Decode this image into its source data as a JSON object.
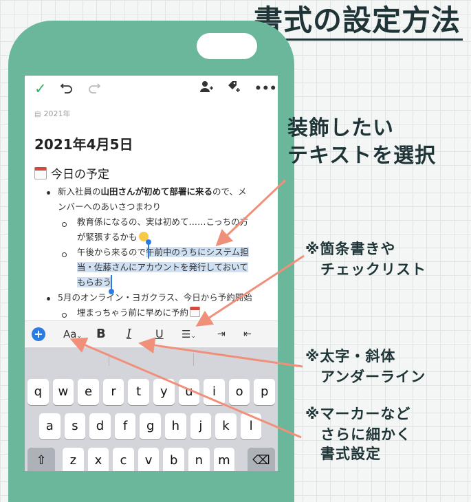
{
  "page_title": "書式の設定方法",
  "toolbar": {
    "check_icon": "check-icon",
    "undo_icon": "undo-icon",
    "redo_icon": "redo-icon",
    "share_icon": "person-add-icon",
    "tag_icon": "tag-add-icon",
    "more_glyph": "•••"
  },
  "note": {
    "notebook": "2021年",
    "title": "2021年4月5日",
    "section_heading": "今日の予定",
    "items": [
      {
        "pre": "新入社員の",
        "bold": "山田さんが初めて部署に来る",
        "post": "ので、メ",
        "line2": "ンバーへのあいさつまわり"
      }
    ],
    "sub1": {
      "line1": "教育係になるの、実は初めて……こっちの方",
      "line2": "が緊張するかも"
    },
    "sub2": {
      "pre": "午後から来るので",
      "sel1": "午前中のうちにシステム担",
      "sel2": "当・佐藤さんにアカウントを発行しておいて",
      "sel3": "もらおう"
    },
    "item2": "5月のオンライン・ヨガクラス、今日から予約開始",
    "sub3": "埋まっちゃう前に早めに予約"
  },
  "format_bar": {
    "plus": "+",
    "aa": "Aa",
    "chev": "⌄",
    "bold": "B",
    "italic": "I",
    "underline": "U",
    "list": "☰",
    "list_chev": "⌄",
    "indent": "⇥",
    "outdent": "⇤"
  },
  "keyboard": {
    "row1": [
      "q",
      "w",
      "e",
      "r",
      "t",
      "y",
      "u",
      "i",
      "o",
      "p"
    ],
    "row2": [
      "a",
      "s",
      "d",
      "f",
      "g",
      "h",
      "j",
      "k",
      "l"
    ],
    "row3": [
      "z",
      "x",
      "c",
      "v",
      "b",
      "n",
      "m"
    ],
    "shift": "⇧",
    "delete": "⌫"
  },
  "annotations": {
    "select_line1": "装飾したい",
    "select_line2": "テキストを選択",
    "list_line1": "※箇条書きや",
    "list_line2": "チェックリスト",
    "bold_line1": "※太字・斜体",
    "bold_line2": "アンダーライン",
    "marker_line1": "※マーカーなど",
    "marker_line2": "さらに細かく",
    "marker_line3": "書式設定"
  },
  "colors": {
    "phone": "#6ab79b",
    "arrow": "#f0907a",
    "accent_blue": "#2a7be4",
    "selection": "#cfe0f3",
    "check_green": "#2fb267"
  }
}
